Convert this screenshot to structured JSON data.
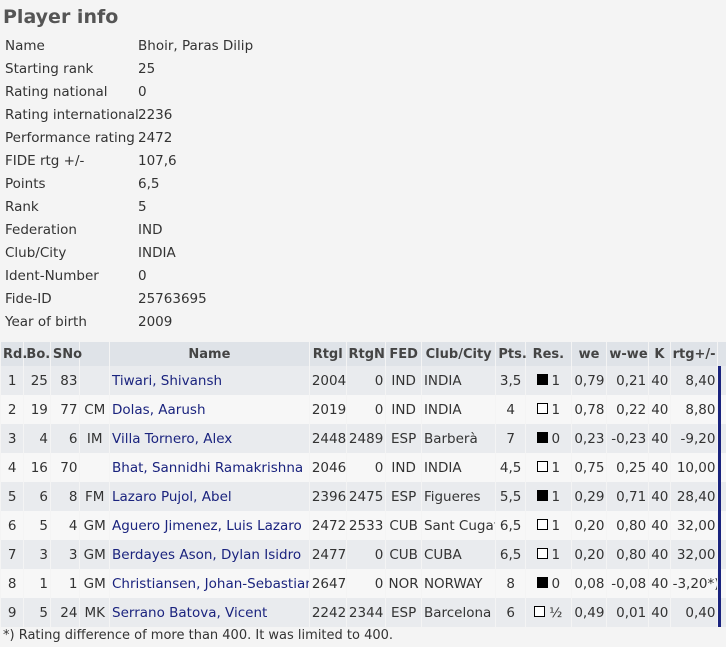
{
  "page_title": "Player info",
  "player_info": [
    {
      "label": "Name",
      "value": "Bhoir, Paras Dilip"
    },
    {
      "label": "Starting rank",
      "value": "25"
    },
    {
      "label": "Rating national",
      "value": "0"
    },
    {
      "label": "Rating international",
      "value": "2236"
    },
    {
      "label": "Performance rating",
      "value": "2472"
    },
    {
      "label": "FIDE rtg +/-",
      "value": "107,6"
    },
    {
      "label": "Points",
      "value": "6,5"
    },
    {
      "label": "Rank",
      "value": "5"
    },
    {
      "label": "Federation",
      "value": "IND"
    },
    {
      "label": "Club/City",
      "value": "INDIA"
    },
    {
      "label": "Ident-Number",
      "value": "0"
    },
    {
      "label": "Fide-ID",
      "value": "25763695"
    },
    {
      "label": "Year of birth",
      "value": "2009"
    }
  ],
  "games_table": {
    "headers": [
      "Rd.",
      "Bo.",
      "SNo",
      "",
      "Name",
      "Rtgl",
      "RtgN",
      "FED",
      "Club/City",
      "Pts.",
      "Res.",
      "we",
      "w-we",
      "K",
      "rtg+/-"
    ],
    "rows": [
      {
        "rd": "1",
        "bo": "25",
        "sno": "83",
        "title": "",
        "name": "Tiwari, Shivansh",
        "rtgi": "2004",
        "rtgn": "0",
        "fed": "IND",
        "club": "INDIA",
        "pts": "3,5",
        "color": "black",
        "res": "1",
        "we": "0,79",
        "wwe": "0,21",
        "k": "40",
        "rtg": "8,40"
      },
      {
        "rd": "2",
        "bo": "19",
        "sno": "77",
        "title": "CM",
        "name": "Dolas, Aarush",
        "rtgi": "2019",
        "rtgn": "0",
        "fed": "IND",
        "club": "INDIA",
        "pts": "4",
        "color": "white",
        "res": "1",
        "we": "0,78",
        "wwe": "0,22",
        "k": "40",
        "rtg": "8,80"
      },
      {
        "rd": "3",
        "bo": "4",
        "sno": "6",
        "title": "IM",
        "name": "Villa Tornero, Alex",
        "rtgi": "2448",
        "rtgn": "2489",
        "fed": "ESP",
        "club": "Barberà",
        "pts": "7",
        "color": "black",
        "res": "0",
        "we": "0,23",
        "wwe": "-0,23",
        "k": "40",
        "rtg": "-9,20"
      },
      {
        "rd": "4",
        "bo": "16",
        "sno": "70",
        "title": "",
        "name": "Bhat, Sannidhi Ramakrishna",
        "rtgi": "2046",
        "rtgn": "0",
        "fed": "IND",
        "club": "INDIA",
        "pts": "4,5",
        "color": "white",
        "res": "1",
        "we": "0,75",
        "wwe": "0,25",
        "k": "40",
        "rtg": "10,00"
      },
      {
        "rd": "5",
        "bo": "6",
        "sno": "8",
        "title": "FM",
        "name": "Lazaro Pujol, Abel",
        "rtgi": "2396",
        "rtgn": "2475",
        "fed": "ESP",
        "club": "Figueres",
        "pts": "5,5",
        "color": "black",
        "res": "1",
        "we": "0,29",
        "wwe": "0,71",
        "k": "40",
        "rtg": "28,40"
      },
      {
        "rd": "6",
        "bo": "5",
        "sno": "4",
        "title": "GM",
        "name": "Aguero Jimenez, Luis Lazaro",
        "rtgi": "2472",
        "rtgn": "2533",
        "fed": "CUB",
        "club": "Sant Cugat",
        "pts": "6,5",
        "color": "white",
        "res": "1",
        "we": "0,20",
        "wwe": "0,80",
        "k": "40",
        "rtg": "32,00"
      },
      {
        "rd": "7",
        "bo": "3",
        "sno": "3",
        "title": "GM",
        "name": "Berdayes Ason, Dylan Isidro",
        "rtgi": "2477",
        "rtgn": "0",
        "fed": "CUB",
        "club": "CUBA",
        "pts": "6,5",
        "color": "white",
        "res": "1",
        "we": "0,20",
        "wwe": "0,80",
        "k": "40",
        "rtg": "32,00"
      },
      {
        "rd": "8",
        "bo": "1",
        "sno": "1",
        "title": "GM",
        "name": "Christiansen, Johan-Sebastian",
        "rtgi": "2647",
        "rtgn": "0",
        "fed": "NOR",
        "club": "NORWAY",
        "pts": "8",
        "color": "black",
        "res": "0",
        "we": "0,08",
        "wwe": "-0,08",
        "k": "40",
        "rtg": "-3,20*)"
      },
      {
        "rd": "9",
        "bo": "5",
        "sno": "24",
        "title": "MK",
        "name": "Serrano Batova, Vicent",
        "rtgi": "2242",
        "rtgn": "2344",
        "fed": "ESP",
        "club": "Barcelona",
        "pts": "6",
        "color": "white",
        "res": "½",
        "we": "0,49",
        "wwe": "0,01",
        "k": "40",
        "rtg": "0,40"
      }
    ]
  },
  "footnote": "*) Rating difference of more than 400. It was limited to 400."
}
